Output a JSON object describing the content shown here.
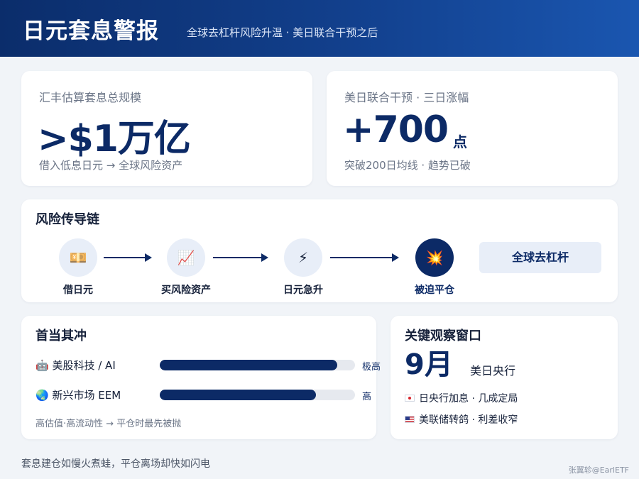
{
  "header": {
    "title": "日元套息警报",
    "subtitle": "全球去杠杆风险升温 · 美日联合干预之后"
  },
  "kpis": [
    {
      "label": "汇丰估算套息总规模",
      "value": ">$1万亿",
      "unit": "",
      "note": "借入低息日元 → 全球风险资产"
    },
    {
      "label": "美日联合干预 · 三日涨幅",
      "value": "+700",
      "unit": "点",
      "note": "突破200日均线 · 趋势已破"
    }
  ],
  "chain": {
    "title": "风险传导链",
    "nodes": [
      {
        "icon": "yen-banknote-icon",
        "glyph": "💴",
        "label": "借日元"
      },
      {
        "icon": "chart-up-icon",
        "glyph": "📈",
        "label": "买风险资产"
      },
      {
        "icon": "lightning-icon",
        "glyph": "⚡",
        "label": "日元急升"
      },
      {
        "icon": "explosion-icon",
        "glyph": "💥",
        "label": "被迫平仓"
      }
    ],
    "result": "全球去杠杆"
  },
  "impact": {
    "title": "首当其冲",
    "rows": [
      {
        "icon": "robot-icon",
        "glyph": "🤖",
        "name": "美股科技 / AI",
        "level": "极高",
        "fill_pct": 91
      },
      {
        "icon": "globe-icon",
        "glyph": "🌏",
        "name": "新兴市场 EEM",
        "level": "高",
        "fill_pct": 80
      }
    ],
    "note": "高估值·高流动性 → 平仓时最先被抛"
  },
  "watch": {
    "title": "关键观察窗口",
    "month": "9月",
    "event": "美日央行",
    "items": [
      {
        "flag": "jp",
        "text": "日央行加息 · 几成定局"
      },
      {
        "flag": "us",
        "text": "美联储转鸽 · 利差收窄"
      }
    ]
  },
  "footer": {
    "note": "套息建仓如慢火煮蛙，平仓离场却快如闪电",
    "credit": "张翼轸@EarlETF"
  },
  "colors": {
    "navy": "#0c2a66",
    "header_start": "#0b2d6b",
    "header_end": "#1a56b0",
    "background": "#f1f4f8"
  }
}
